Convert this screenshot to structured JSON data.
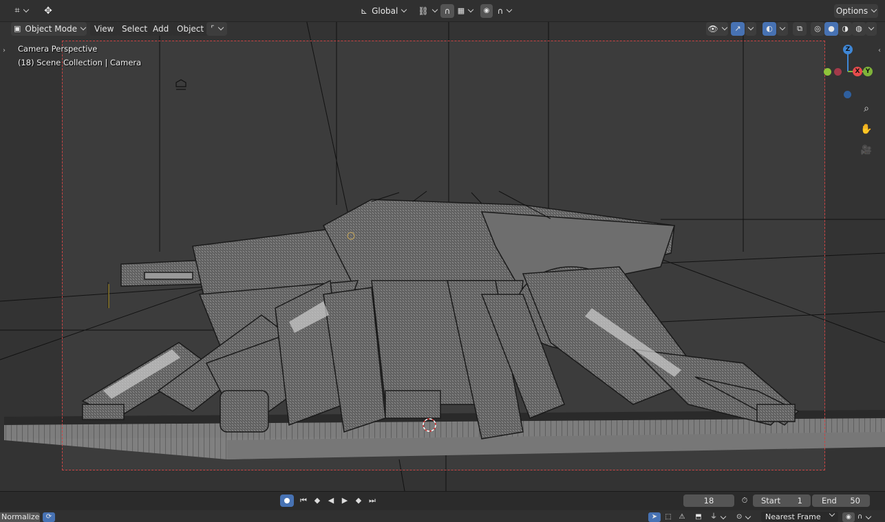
{
  "topbar": {
    "transform_orientation": "Global",
    "options_label": "Options"
  },
  "viewport_header": {
    "mode": "Object Mode",
    "menus": [
      "View",
      "Select",
      "Add",
      "Object"
    ]
  },
  "overlay": {
    "perspective": "Camera Perspective",
    "collection": "(18) Scene Collection | Camera"
  },
  "gizmo": {
    "z": "Z",
    "x": "X",
    "y": "Y"
  },
  "timeline": {
    "current_frame": "18",
    "start_label": "Start",
    "start_value": "1",
    "end_label": "End",
    "end_value": "50"
  },
  "bottombar": {
    "normalize_label": "Normalize",
    "snap_mode": "Nearest Frame"
  },
  "colors": {
    "accent_blue": "#4772b3",
    "camera_frame": "#cc4444",
    "axis_x": "#e74c4c",
    "axis_y": "#7fb33a",
    "axis_z": "#3f87d6"
  }
}
